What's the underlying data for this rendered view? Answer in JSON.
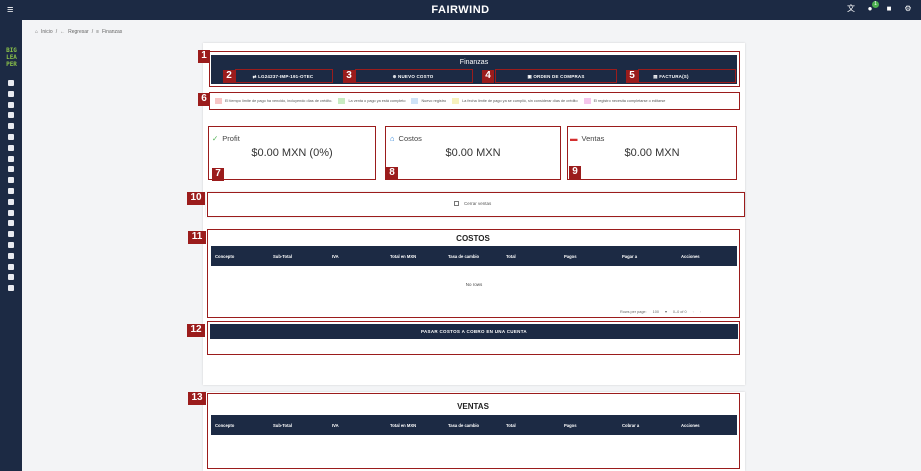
{
  "topbar": {
    "brand": "FAIRWIND",
    "notif_count": "1"
  },
  "sidebar": {
    "logo": "BIG LEA PER"
  },
  "breadcrumb": [
    "Inicio",
    "/",
    "Regresar",
    "/",
    "Finanzas"
  ],
  "header": {
    "title": "Finanzas",
    "reference": "LG24237-IMP-191-OTEC",
    "nuevo_costo": "NUEVO COSTO",
    "orden_compras": "ORDEN DE COMPRAS",
    "facturas": "FACTURA(S)"
  },
  "legend": [
    {
      "text": "El tiempo límite de pago ha vencido, incluyendo días de crédito.",
      "color": "#f7c6c6"
    },
    {
      "text": "La venta o pago ya está completo",
      "color": "#c8ecc2"
    },
    {
      "text": "Nuevo registro",
      "color": "#cfe3f7"
    },
    {
      "text": "La fecha límite de pago ya se cumplió, sin considerar días de crédito",
      "color": "#f7f1bd"
    },
    {
      "text": "El registro necesita completarse o editarse",
      "color": "#f5c6ec"
    }
  ],
  "cards": {
    "profit": {
      "title": "Profit",
      "value": "$0.00 MXN (0%)"
    },
    "costos": {
      "title": "Costos",
      "value": "$0.00 MXN"
    },
    "ventas": {
      "title": "Ventas",
      "value": "$0.00 MXN"
    }
  },
  "cerrar_ventas": "Cerrar ventas",
  "costos_table": {
    "title": "COSTOS",
    "columns": [
      "Concepto",
      "Sub-Total",
      "IVA",
      "Total en MXN",
      "Tasa de cambio",
      "Total",
      "Pagos",
      "Pagar a",
      "Acciones"
    ],
    "empty": "No rows",
    "rows_per_page_label": "Rows per page:",
    "rows_per_page": "100",
    "range": "0–0 of 0"
  },
  "pasar_costos": "PASAR COSTOS A COBRO EN UNA CUENTA",
  "ventas_table": {
    "title": "VENTAS",
    "columns": [
      "Concepto",
      "Sub-Total",
      "IVA",
      "Total en MXN",
      "Tasa de cambio",
      "Total",
      "Pagos",
      "Cobrar a",
      "Acciones"
    ]
  },
  "markers": [
    "1",
    "2",
    "3",
    "4",
    "5",
    "6",
    "7",
    "8",
    "9",
    "10",
    "11",
    "12",
    "13"
  ]
}
